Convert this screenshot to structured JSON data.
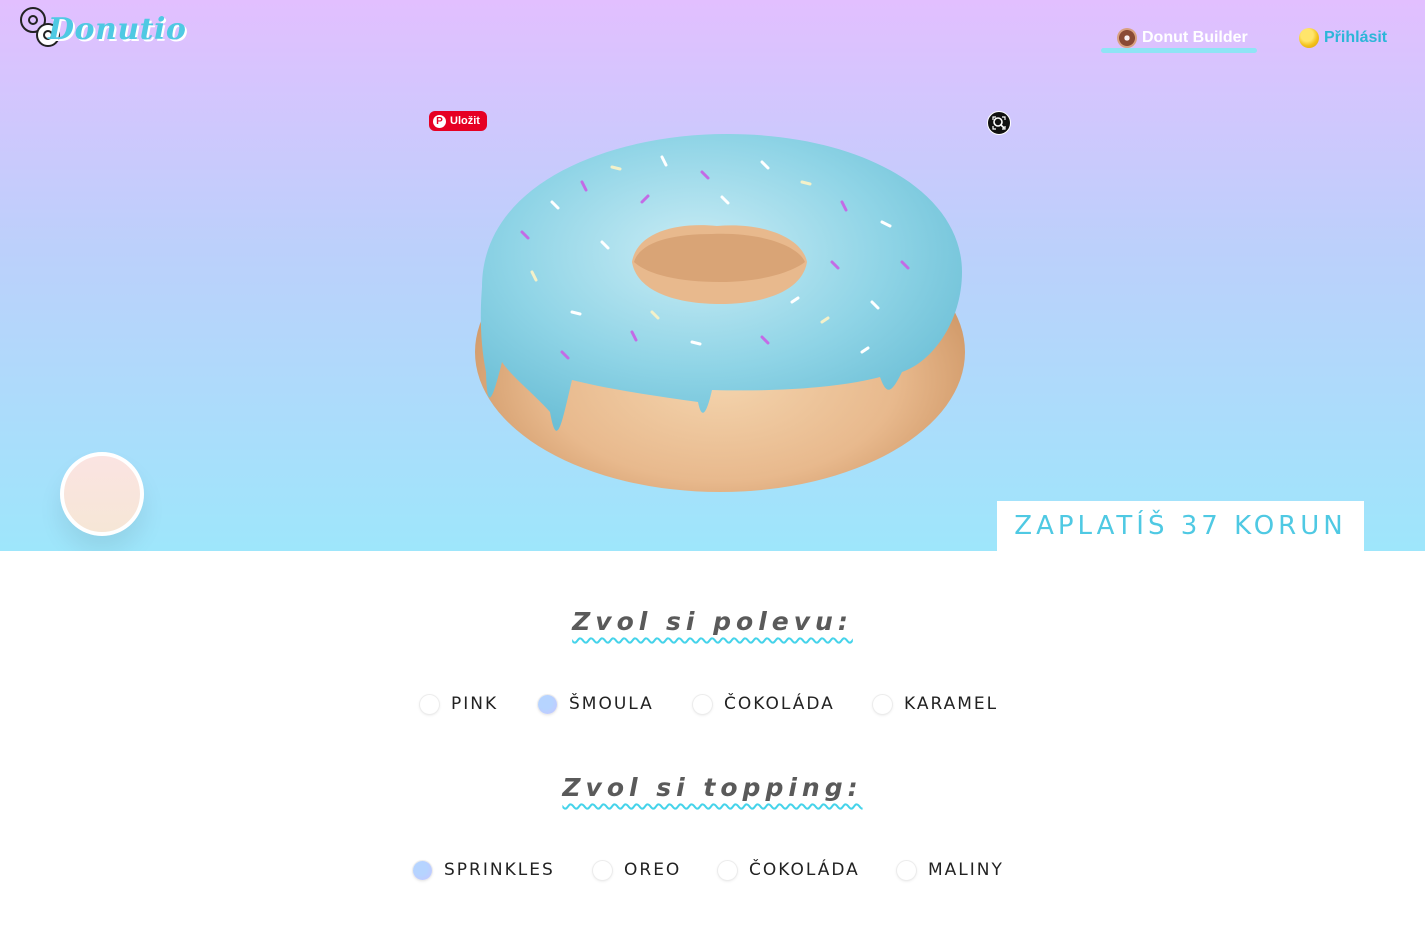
{
  "brand": {
    "name": "Donutio"
  },
  "nav": {
    "builder_label": "Donut Builder",
    "login_label": "Přihlásit"
  },
  "hero": {
    "pin_label": "Uložit",
    "price_label": "ZAPLATÍŠ 37 KORUN",
    "glaze_color": "#8fd4e6",
    "dough_color": "#e8b98d"
  },
  "glaze": {
    "title": "Zvol si polevu:",
    "options": [
      "PINK",
      "ŠMOULA",
      "ČOKOLÁDA",
      "KARAMEL"
    ],
    "selected": "ŠMOULA"
  },
  "topping": {
    "title": "Zvol si topping:",
    "options": [
      "SPRINKLES",
      "OREO",
      "ČOKOLÁDA",
      "MALINY"
    ],
    "selected": "SPRINKLES"
  },
  "colors": {
    "accent": "#4fc9e3",
    "gradient_top": "#e2bfff",
    "gradient_bottom": "#9ee6fb",
    "pinterest": "#e60023"
  }
}
